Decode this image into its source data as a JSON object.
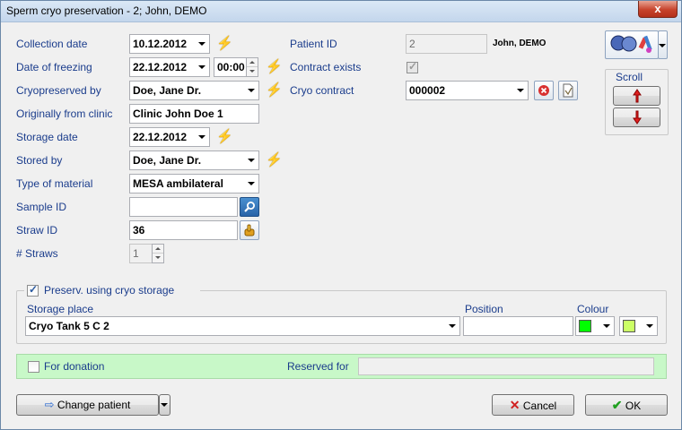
{
  "window": {
    "title": "Sperm cryo preservation - 2; John, DEMO",
    "close_glyph": "x"
  },
  "form": {
    "collection_date": {
      "label": "Collection date",
      "value": "10.12.2012"
    },
    "date_of_freezing": {
      "label": "Date of freezing",
      "value": "22.12.2012",
      "time": "00:00"
    },
    "cryopreserved_by": {
      "label": "Cryopreserved by",
      "value": "Doe, Jane Dr."
    },
    "originally_from_clinic": {
      "label": "Originally from clinic",
      "value": "Clinic John Doe 1"
    },
    "storage_date": {
      "label": "Storage date",
      "value": "22.12.2012"
    },
    "stored_by": {
      "label": "Stored by",
      "value": "Doe, Jane Dr."
    },
    "type_of_material": {
      "label": "Type of material",
      "value": "MESA ambilateral"
    },
    "sample_id": {
      "label": "Sample ID",
      "value": ""
    },
    "straw_id": {
      "label": "Straw ID",
      "value": "36"
    },
    "num_straws": {
      "label": "# Straws",
      "value": "1"
    },
    "patient_id": {
      "label": "Patient ID",
      "value": "2",
      "name": "John, DEMO"
    },
    "contract_exists": {
      "label": "Contract exists",
      "checked": true
    },
    "cryo_contract": {
      "label": "Cryo contract",
      "value": "000002"
    }
  },
  "scroll_panel": {
    "label": "Scroll"
  },
  "storage": {
    "group_label": "Preserv. using cryo storage",
    "checked": true,
    "storage_place_label": "Storage place",
    "storage_place_value": "Cryo Tank 5 C 2",
    "position_label": "Position",
    "position_value": "",
    "colour_label": "Colour",
    "colour_1": "#00ff00",
    "colour_2": "#ccff66"
  },
  "donation": {
    "label": "For donation",
    "checked": false,
    "reserved_for_label": "Reserved for",
    "reserved_for_value": ""
  },
  "buttons": {
    "change_patient": "Change patient",
    "cancel": "Cancel",
    "ok": "OK"
  },
  "colors": {
    "label_blue": "#1a3c8c",
    "donation_bg": "#c8f8c8",
    "bolt": "#e8d000"
  }
}
